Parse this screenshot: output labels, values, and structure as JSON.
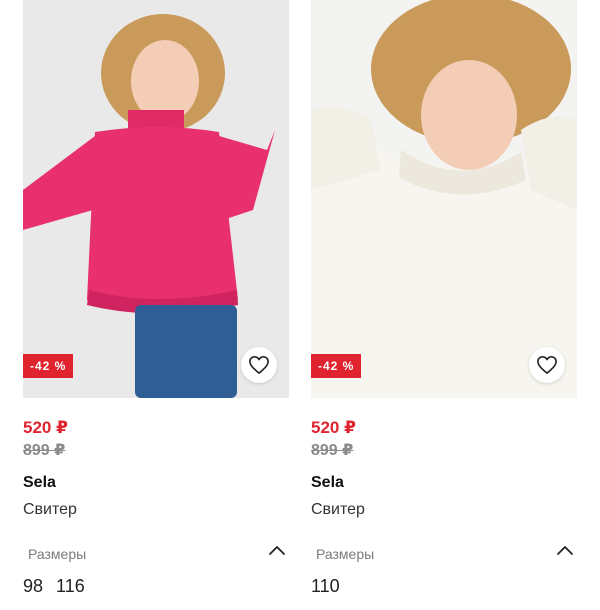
{
  "products": [
    {
      "discount": "-42 %",
      "price": "520 ₽",
      "old_price": "899 ₽",
      "brand": "Sela",
      "type": "Свитер",
      "sizes_label": "Размеры",
      "sizes": [
        "98",
        "116"
      ],
      "color": "#e8306f",
      "icons": [
        "heart-icon",
        "chevron-up-icon"
      ]
    },
    {
      "discount": "-42 %",
      "price": "520 ₽",
      "old_price": "899 ₽",
      "brand": "Sela",
      "type": "Свитер",
      "sizes_label": "Размеры",
      "sizes": [
        "110"
      ],
      "color": "#f6f4ee",
      "icons": [
        "heart-icon",
        "chevron-up-icon"
      ]
    }
  ],
  "colors": {
    "sale": "#e0242f",
    "old_price": "#8a8a8a"
  }
}
